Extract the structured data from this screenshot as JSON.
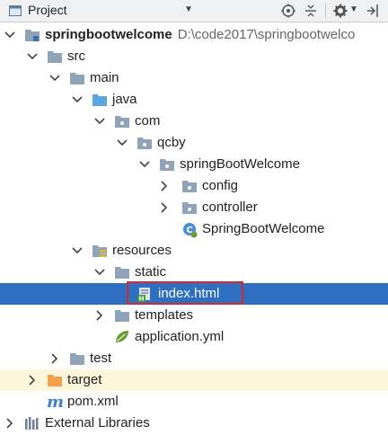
{
  "toolbar": {
    "title": "Project",
    "icons": [
      "project-view-icon",
      "dropdown-icon",
      "locate-icon",
      "collapse-all-icon",
      "settings-icon",
      "hide-icon"
    ]
  },
  "tree": {
    "root_label": "springbootwelcome",
    "root_path": "D:\\code2017\\springbootwelco",
    "src": "src",
    "main": "main",
    "java": "java",
    "com": "com",
    "qcby": "qcby",
    "package": "springBootWelcome",
    "config": "config",
    "controller": "controller",
    "app_class": "SpringBootWelcome",
    "resources": "resources",
    "static": "static",
    "index_html": "index.html",
    "templates": "templates",
    "app_yml": "application.yml",
    "test": "test",
    "target": "target",
    "pom": "pom.xml",
    "ext_libs": "External Libraries"
  },
  "colors": {
    "selection": "#2f6fc2",
    "target_row": "#fbf6dc",
    "highlight_border": "#d62b2b",
    "folder": "#8fa4b8",
    "source_folder": "#5aa7e0",
    "excluded_folder": "#f2a04b"
  }
}
